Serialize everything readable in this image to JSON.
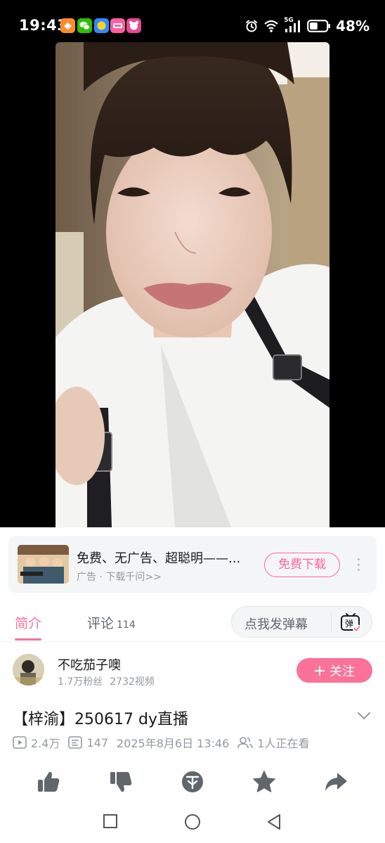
{
  "status_bar": {
    "time": "19:43",
    "battery_percent": "48%",
    "battery_level": 0.48,
    "network": "5G",
    "app_icons": [
      "orange-app-icon",
      "wechat-icon",
      "yellow-app-icon",
      "pink-app-icon",
      "pink-bear-app-icon"
    ]
  },
  "ad": {
    "title": "免费、无广告、超聪明——...",
    "subtitle": "广告 · 下载千问>>",
    "button": "免费下载"
  },
  "tabs": {
    "intro": "简介",
    "comments": "评论",
    "comments_count": "114",
    "danmaku_placeholder": "点我发弹幕",
    "danmaku_icon_text": "弹"
  },
  "uploader": {
    "name": "不吃茄子噢",
    "fans": "1.7万粉丝",
    "videos": "2732视频",
    "follow": "关注"
  },
  "video": {
    "title": "【梓渝】250617 dy直播",
    "views": "2.4万",
    "danmaku_count": "147",
    "date": "2025年8月6日 13:46",
    "watching": "1人正在看"
  },
  "colors": {
    "accent": "#fb7299",
    "text": "#18191c",
    "secondary": "#9499a0"
  }
}
